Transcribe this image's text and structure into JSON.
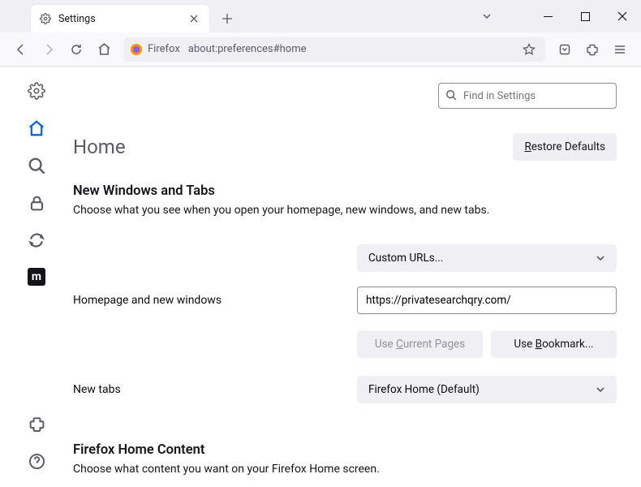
{
  "window": {
    "tab_title": "Settings"
  },
  "toolbar": {
    "fx_label": "Firefox",
    "url": "about:preferences#home"
  },
  "search": {
    "placeholder": "Find in Settings"
  },
  "page": {
    "heading": "Home",
    "restore_btn": "Restore Defaults",
    "section1_title": "New Windows and Tabs",
    "section1_desc": "Choose what you see when you open your homepage, new windows, and new tabs.",
    "homepage_label": "Homepage and new windows",
    "homepage_select": "Custom URLs...",
    "homepage_url": "https://privatesearchqry.com/",
    "use_current": "Use Current Pages",
    "use_bookmark": "Use Bookmark...",
    "newtabs_label": "New tabs",
    "newtabs_select": "Firefox Home (Default)",
    "section2_title": "Firefox Home Content",
    "section2_desc": "Choose what content you want on your Firefox Home screen."
  }
}
